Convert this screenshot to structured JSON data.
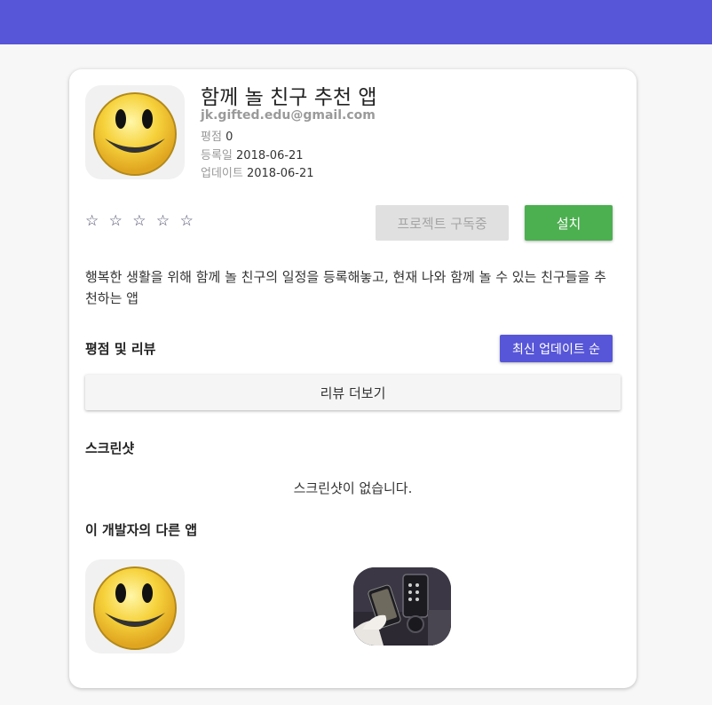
{
  "app": {
    "title": "함께 놀 친구 추천 앱",
    "email": "jk.gifted.edu@gmail.com",
    "rating_label": "평점",
    "rating_value": "0",
    "registered_label": "등록일",
    "registered_value": "2018-06-21",
    "updated_label": "업데이트",
    "updated_value": "2018-06-21",
    "icon": "smiley-face-icon",
    "stars": "☆ ☆ ☆ ☆ ☆",
    "description": "행복한 생활을 위해 함께 놀 친구의 일정을 등록해놓고, 현재 나와 함께 놀 수 있는 친구들을 추천하는 앱"
  },
  "actions": {
    "subscribe_label": "프로젝트 구독중",
    "install_label": "설치"
  },
  "reviews": {
    "heading": "평점 및 리뷰",
    "sort_label": "최신 업데이트 순",
    "more_label": "리뷰 더보기"
  },
  "screenshots": {
    "heading": "스크린샷",
    "empty_text": "스크린샷이 없습니다."
  },
  "other_apps": {
    "heading": "이 개발자의 다른 앱",
    "items": [
      {
        "icon": "smiley-face-icon"
      },
      {
        "icon": "smart-door-lock-photo"
      }
    ]
  },
  "colors": {
    "topbar": "#5756d8",
    "install": "#4caf50",
    "sort": "#5756d8"
  }
}
